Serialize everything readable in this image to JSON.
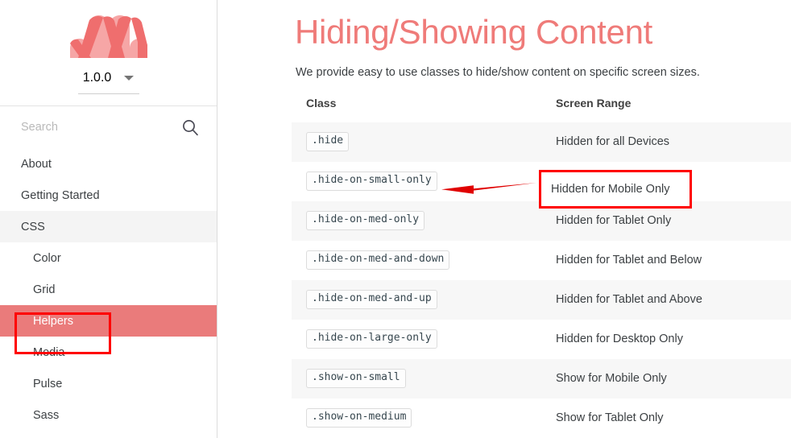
{
  "sidebar": {
    "logo": {
      "icon": "materialize-m-logo",
      "color_dark": "#ef6e6e",
      "color_light": "#f6a6a6"
    },
    "version": {
      "value": "1.0.0",
      "caret_icon": "chevron-down-icon"
    },
    "search": {
      "placeholder": "Search",
      "value": "",
      "icon": "search-icon"
    },
    "items": [
      {
        "label": "About",
        "level": "top",
        "state": "normal"
      },
      {
        "label": "Getting Started",
        "level": "top",
        "state": "normal"
      },
      {
        "label": "CSS",
        "level": "top",
        "state": "section-active"
      },
      {
        "label": "Color",
        "level": "sub",
        "state": "normal"
      },
      {
        "label": "Grid",
        "level": "sub",
        "state": "normal"
      },
      {
        "label": "Helpers",
        "level": "sub",
        "state": "page-active"
      },
      {
        "label": "Media",
        "level": "sub",
        "state": "normal"
      },
      {
        "label": "Pulse",
        "level": "sub",
        "state": "normal"
      },
      {
        "label": "Sass",
        "level": "sub",
        "state": "normal"
      }
    ]
  },
  "main": {
    "title": "Hiding/Showing Content",
    "subtitle": "We provide easy to use classes to hide/show content on specific screen sizes.",
    "table": {
      "headers": [
        "Class",
        "Screen Range"
      ],
      "rows": [
        {
          "class": ".hide",
          "range": "Hidden for all Devices"
        },
        {
          "class": ".hide-on-small-only",
          "range": "Hidden for Mobile Only"
        },
        {
          "class": ".hide-on-med-only",
          "range": "Hidden for Tablet Only"
        },
        {
          "class": ".hide-on-med-and-down",
          "range": "Hidden for Tablet and Below"
        },
        {
          "class": ".hide-on-med-and-up",
          "range": "Hidden for Tablet and Above"
        },
        {
          "class": ".hide-on-large-only",
          "range": "Hidden for Desktop Only"
        },
        {
          "class": ".show-on-small",
          "range": "Show for Mobile Only"
        },
        {
          "class": ".show-on-medium",
          "range": "Show for Tablet Only"
        }
      ]
    }
  },
  "annotations": {
    "color": "#ff0000",
    "highlight_helpers": {
      "target": "Helpers"
    },
    "highlight_mobile_row": {
      "target": "Hidden for Mobile Only",
      "label": "Hidden for Mobile Only"
    },
    "arrow": {
      "direction": "left",
      "from": "Hidden for Mobile Only",
      "to": ".hide-on-small-only"
    }
  },
  "colors": {
    "accent": "#ef7b79",
    "active_nav_bg": "#ea7b7b",
    "section_nav_bg": "#f4f4f4",
    "row_stripe": "#f7f7f7",
    "annotation_red": "#ff0000"
  }
}
